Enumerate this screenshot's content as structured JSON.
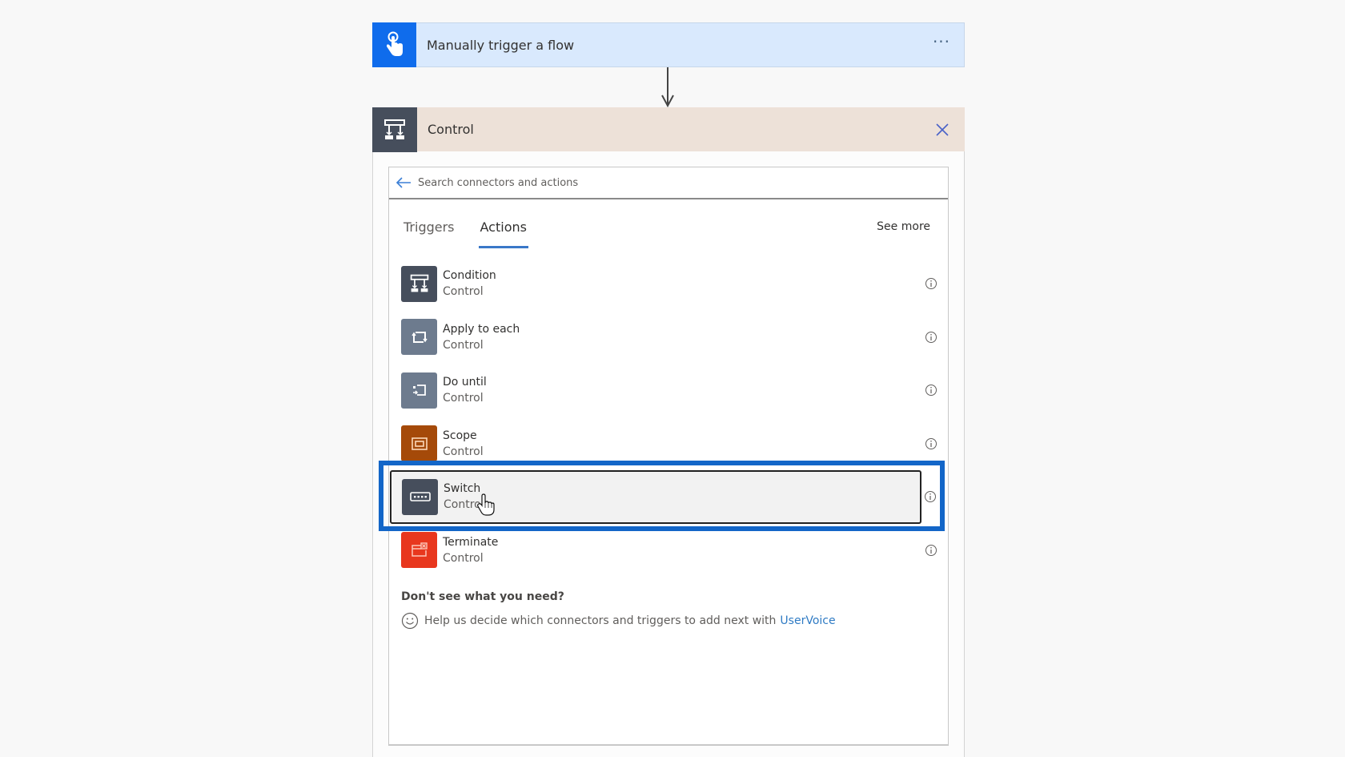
{
  "trigger": {
    "title": "Manually trigger a flow",
    "icon": "touch-hand-icon",
    "menu_label": "···",
    "accent": "#0f6cec"
  },
  "control": {
    "title": "Control",
    "icon": "condition-icon",
    "close_icon": "close-icon"
  },
  "search": {
    "placeholder": "Search connectors and actions",
    "value": ""
  },
  "tabs": [
    {
      "label": "Triggers",
      "active": false
    },
    {
      "label": "Actions",
      "active": true
    }
  ],
  "see_more_label": "See more",
  "actions": [
    {
      "name": "Condition",
      "category": "Control",
      "icon": "condition-icon",
      "color": "#464e5c"
    },
    {
      "name": "Apply to each",
      "category": "Control",
      "icon": "loop-icon",
      "color": "#6d7b8e"
    },
    {
      "name": "Do until",
      "category": "Control",
      "icon": "do-until-icon",
      "color": "#6d7b8e"
    },
    {
      "name": "Scope",
      "category": "Control",
      "icon": "scope-icon",
      "color": "#a54a09"
    },
    {
      "name": "Switch",
      "category": "Control",
      "icon": "switch-icon",
      "color": "#464e5c",
      "selected": true
    },
    {
      "name": "Terminate",
      "category": "Control",
      "icon": "terminate-icon",
      "color": "#e8371e"
    }
  ],
  "help": {
    "title": "Don't see what you need?",
    "text": "Help us decide which connectors and triggers to add next with",
    "link": "UserVoice"
  },
  "highlight_color": "#1366c8"
}
